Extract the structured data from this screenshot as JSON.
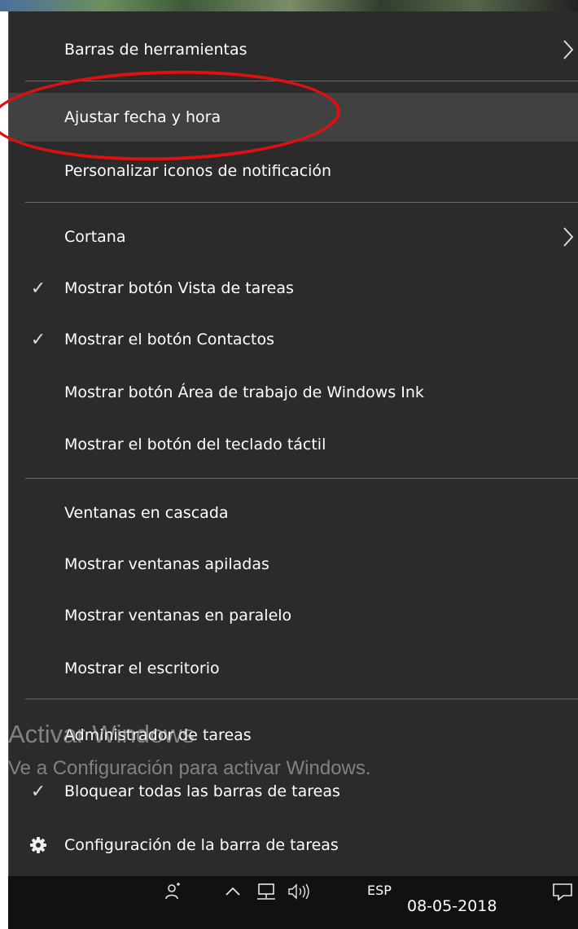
{
  "menu": {
    "items": [
      {
        "label": "Barras de herramientas",
        "checked": false,
        "submenu": true
      },
      {
        "label": "Ajustar fecha y hora",
        "checked": false,
        "submenu": false,
        "highlighted": true
      },
      {
        "label": "Personalizar iconos de notificación",
        "checked": false,
        "submenu": false
      },
      {
        "label": "Cortana",
        "checked": false,
        "submenu": true
      },
      {
        "label": "Mostrar botón Vista de tareas",
        "checked": true,
        "submenu": false
      },
      {
        "label": "Mostrar el botón Contactos",
        "checked": true,
        "submenu": false
      },
      {
        "label": "Mostrar botón Área de trabajo de Windows Ink",
        "checked": false,
        "submenu": false
      },
      {
        "label": "Mostrar el botón del teclado táctil",
        "checked": false,
        "submenu": false
      },
      {
        "label": "Ventanas en cascada",
        "checked": false,
        "submenu": false
      },
      {
        "label": "Mostrar ventanas apiladas",
        "checked": false,
        "submenu": false
      },
      {
        "label": "Mostrar ventanas en paralelo",
        "checked": false,
        "submenu": false
      },
      {
        "label": "Mostrar el escritorio",
        "checked": false,
        "submenu": false
      },
      {
        "label": "Administrador de tareas",
        "checked": false,
        "submenu": false
      },
      {
        "label": "Bloquear todas las barras de tareas",
        "checked": true,
        "submenu": false
      },
      {
        "label": "Configuración de la barra de tareas",
        "checked": false,
        "submenu": false,
        "icon": "gear-icon"
      }
    ],
    "check_glyph": "✓",
    "colors": {
      "background": "#2b2b2b",
      "highlight": "#414141",
      "text": "#ffffff",
      "annotation": "#e01010"
    }
  },
  "watermark": {
    "title": "Activar Windows",
    "subtitle": "Ve a Configuración para activar Windows."
  },
  "taskbar": {
    "icons": [
      "people-icon",
      "chevron-up-icon",
      "network-icon",
      "volume-icon",
      "action-center-icon"
    ],
    "language": "ESP",
    "date": "08-05-2018"
  }
}
